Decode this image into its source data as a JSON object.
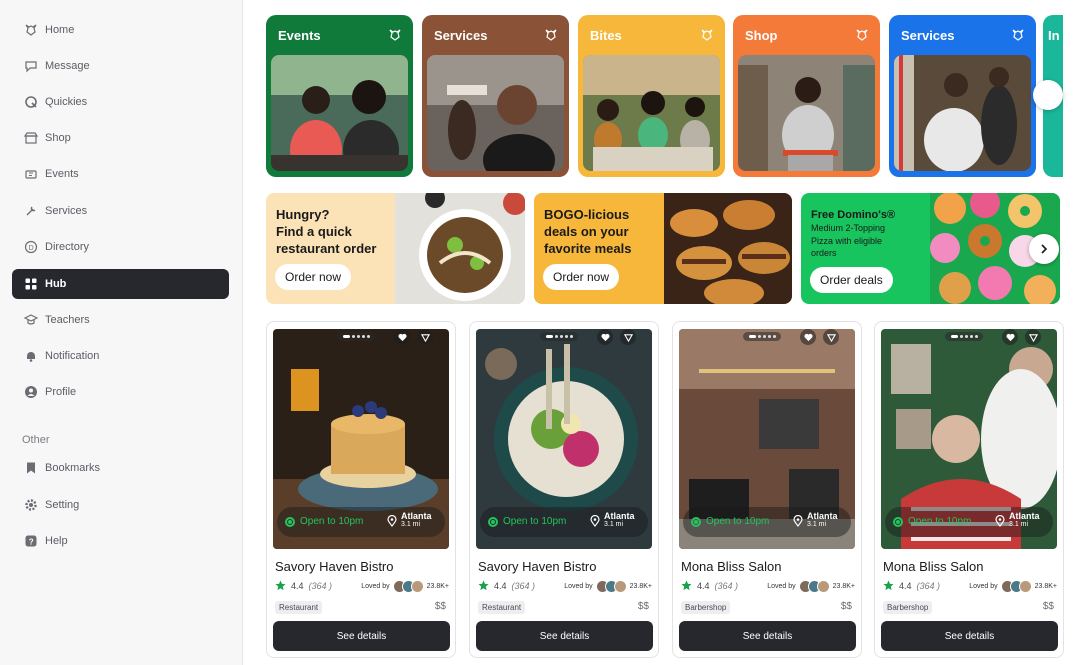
{
  "sidebar": {
    "items": [
      {
        "label": "Home",
        "icon": "lion-logo-icon"
      },
      {
        "label": "Message",
        "icon": "chat-icon"
      },
      {
        "label": "Quickies",
        "icon": "q-icon"
      },
      {
        "label": "Shop",
        "icon": "storefront-icon"
      },
      {
        "label": "Events",
        "icon": "ticket-icon"
      },
      {
        "label": "Services",
        "icon": "tools-icon"
      },
      {
        "label": "Directory",
        "icon": "directory-icon"
      },
      {
        "label": "Hub",
        "icon": "grid-icon",
        "active": true
      },
      {
        "label": "Teachers",
        "icon": "graduation-cap-icon"
      },
      {
        "label": "Notification",
        "icon": "bell-icon"
      },
      {
        "label": "Profile",
        "icon": "user-icon"
      }
    ],
    "other_label": "Other",
    "other_items": [
      {
        "label": "Bookmarks",
        "icon": "bookmark-icon"
      },
      {
        "label": "Setting",
        "icon": "gear-icon"
      },
      {
        "label": "Help",
        "icon": "help-icon"
      }
    ]
  },
  "categories": [
    {
      "label": "Events",
      "color": "#0f7a3a"
    },
    {
      "label": "Services",
      "color": "#8a5236"
    },
    {
      "label": "Bites",
      "color": "#f6b73a"
    },
    {
      "label": "Shop",
      "color": "#f47a3a"
    },
    {
      "label": "Services",
      "color": "#1a73e8"
    },
    {
      "label": "In",
      "color": "#1bb79a"
    }
  ],
  "promos": [
    {
      "lines": [
        "Hungry?",
        "Find a quick",
        "restaurant order"
      ],
      "button": "Order now",
      "bg": "#fbe3b7"
    },
    {
      "lines": [
        "BOGO-licious",
        "deals on your",
        "favorite meals"
      ],
      "button": "Order now",
      "bg": "#f6b73a"
    },
    {
      "title": "Free Domino's®",
      "lines": [
        "Medium 2-Topping",
        "Pizza with eligible",
        "orders"
      ],
      "button": "Order deals",
      "bg": "#18c45e"
    }
  ],
  "businesses": [
    {
      "name": "Savory Haven Bistro",
      "rating": "4.4",
      "count": "(364 )",
      "loved_label": "Loved by",
      "loved_count": "23.8K+",
      "tag": "Restaurant",
      "price": "$$",
      "status": "Open to 10pm",
      "city": "Atlanta",
      "distance": "3.1 mi",
      "button": "See details"
    },
    {
      "name": "Savory Haven Bistro",
      "rating": "4.4",
      "count": "(364 )",
      "loved_label": "Loved by",
      "loved_count": "23.8K+",
      "tag": "Restaurant",
      "price": "$$",
      "status": "Open to 10pm",
      "city": "Atlanta",
      "distance": "3.1 mi",
      "button": "See details"
    },
    {
      "name": "Mona Bliss Salon",
      "rating": "4.4",
      "count": "(364 )",
      "loved_label": "Loved by",
      "loved_count": "23.8K+",
      "tag": "Barbershop",
      "price": "$$",
      "status": "Open to 10pm",
      "city": "Atlanta",
      "distance": "3.1 mi",
      "button": "See details"
    },
    {
      "name": "Mona Bliss Salon",
      "rating": "4.4",
      "count": "(364 )",
      "loved_label": "Loved by",
      "loved_count": "23.8K+",
      "tag": "Barbershop",
      "price": "$$",
      "status": "Open to 10pm",
      "city": "Atlanta",
      "distance": "3.1 mi",
      "button": "See details"
    }
  ],
  "colors": {
    "accent_dark": "#26282e",
    "open_green": "#22c55e",
    "star_green": "#16a34a"
  }
}
